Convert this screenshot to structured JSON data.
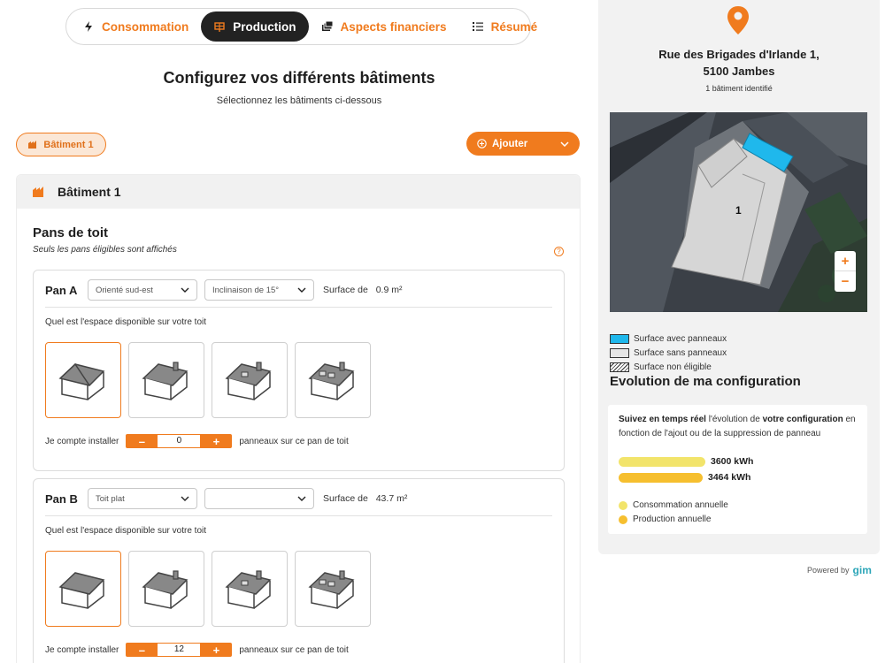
{
  "nav": {
    "items": [
      {
        "label": "Consommation",
        "icon": "lightning-icon",
        "active": false
      },
      {
        "label": "Production",
        "icon": "solar-panel-icon",
        "active": true
      },
      {
        "label": "Aspects financiers",
        "icon": "money-icon",
        "active": false
      },
      {
        "label": "Résumé",
        "icon": "list-icon",
        "active": false
      }
    ]
  },
  "header": {
    "title": "Configurez vos différents bâtiments",
    "subtitle": "Sélectionnez les bâtiments ci-dessous"
  },
  "building_chip": "Bâtiment 1",
  "add_button": "Ajouter",
  "building": {
    "title": "Bâtiment 1",
    "pans_title": "Pans de toit",
    "pans_subtitle": "Seuls les pans éligibles sont affichés",
    "help": "?",
    "pans": [
      {
        "name": "Pan A",
        "orientation": "Orienté sud-est",
        "inclination": "Inclinaison de 15°",
        "surface_label": "Surface de",
        "surface_value": "0.9",
        "surface_unit": "m²",
        "question": "Quel est l'espace disponible sur votre toit",
        "install_prefix": "Je compte installer",
        "panels": "0",
        "install_suffix": "panneaux sur ce pan de toit",
        "selected_option": 0
      },
      {
        "name": "Pan B",
        "orientation": "Toit plat",
        "inclination": "",
        "surface_label": "Surface de",
        "surface_value": "43.7",
        "surface_unit": "m²",
        "question": "Quel est l'espace disponible sur votre toit",
        "install_prefix": "Je compte installer",
        "panels": "12",
        "install_suffix": "panneaux sur ce pan de toit",
        "selected_option": 0
      }
    ]
  },
  "stepper": {
    "minus": "–",
    "plus": "+"
  },
  "sidebar": {
    "address_line1": "Rue des Brigades d'Irlande 1,",
    "address_line2": "5100 Jambes",
    "building_count": "1 bâtiment identifié",
    "map_label": "1",
    "zoom_in": "+",
    "zoom_out": "−",
    "legend": [
      {
        "label": "Surface avec panneaux",
        "color": "#1fb8ec"
      },
      {
        "label": "Surface sans panneaux",
        "color": "#e6e6e6"
      },
      {
        "label": "Surface non éligible",
        "color": "hatched"
      }
    ],
    "evolution_title": "Evolution de ma configuration",
    "evolution_desc_bold1": "Suivez en temps réel",
    "evolution_desc_mid": " l'évolution de ",
    "evolution_desc_bold2": "votre configuration",
    "evolution_desc_end": " en fonction de l'ajout ou de la suppression de panneau",
    "consumption_value": "3600 kWh",
    "production_value": "3464 kWh",
    "consumption_label": "Consommation annuelle",
    "production_label": "Production annuelle",
    "consumption_color": "#f2e46b",
    "production_color": "#f6bf2f"
  },
  "powered": {
    "label": "Powered by",
    "brand": "gim"
  },
  "colors": {
    "accent": "#f07b1e"
  }
}
